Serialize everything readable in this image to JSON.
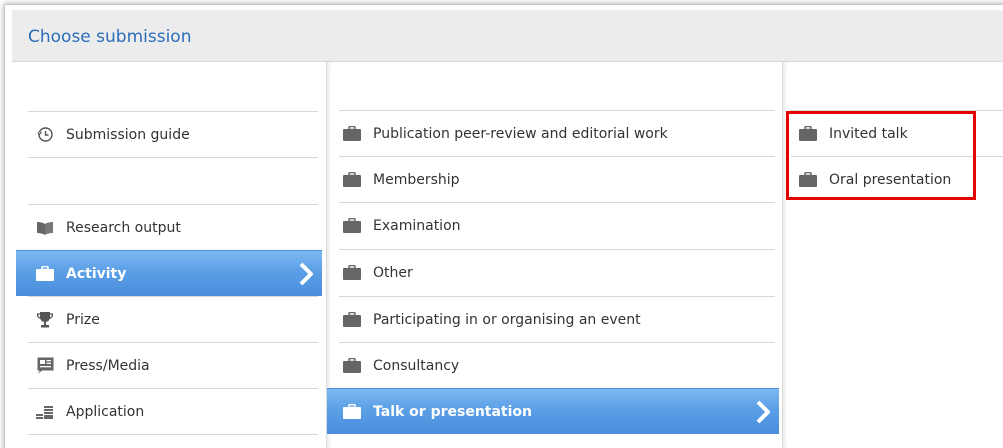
{
  "dialog": {
    "title": "Choose submission"
  },
  "col1": {
    "items": [
      {
        "label": "Submission guide",
        "icon": "clock-history-icon"
      },
      {
        "label": "Research output",
        "icon": "book-icon"
      },
      {
        "label": "Activity",
        "icon": "briefcase-icon",
        "selected": true
      },
      {
        "label": "Prize",
        "icon": "trophy-icon"
      },
      {
        "label": "Press/Media",
        "icon": "news-icon"
      },
      {
        "label": "Application",
        "icon": "coins-icon"
      }
    ]
  },
  "col2": {
    "items": [
      {
        "label": "Publication peer-review and editorial work",
        "icon": "briefcase-icon"
      },
      {
        "label": "Membership",
        "icon": "briefcase-icon"
      },
      {
        "label": "Examination",
        "icon": "briefcase-icon"
      },
      {
        "label": "Other",
        "icon": "briefcase-icon"
      },
      {
        "label": "Participating in or organising an event",
        "icon": "briefcase-icon"
      },
      {
        "label": "Consultancy",
        "icon": "briefcase-icon"
      },
      {
        "label": "Talk or presentation",
        "icon": "briefcase-icon",
        "selected": true
      }
    ]
  },
  "col3": {
    "items": [
      {
        "label": "Invited talk",
        "icon": "briefcase-icon"
      },
      {
        "label": "Oral presentation",
        "icon": "briefcase-icon"
      }
    ]
  },
  "colors": {
    "title": "#2a6ebb",
    "selected": "#5b9fe6",
    "highlight": "#e60000",
    "icon": "#666666"
  }
}
